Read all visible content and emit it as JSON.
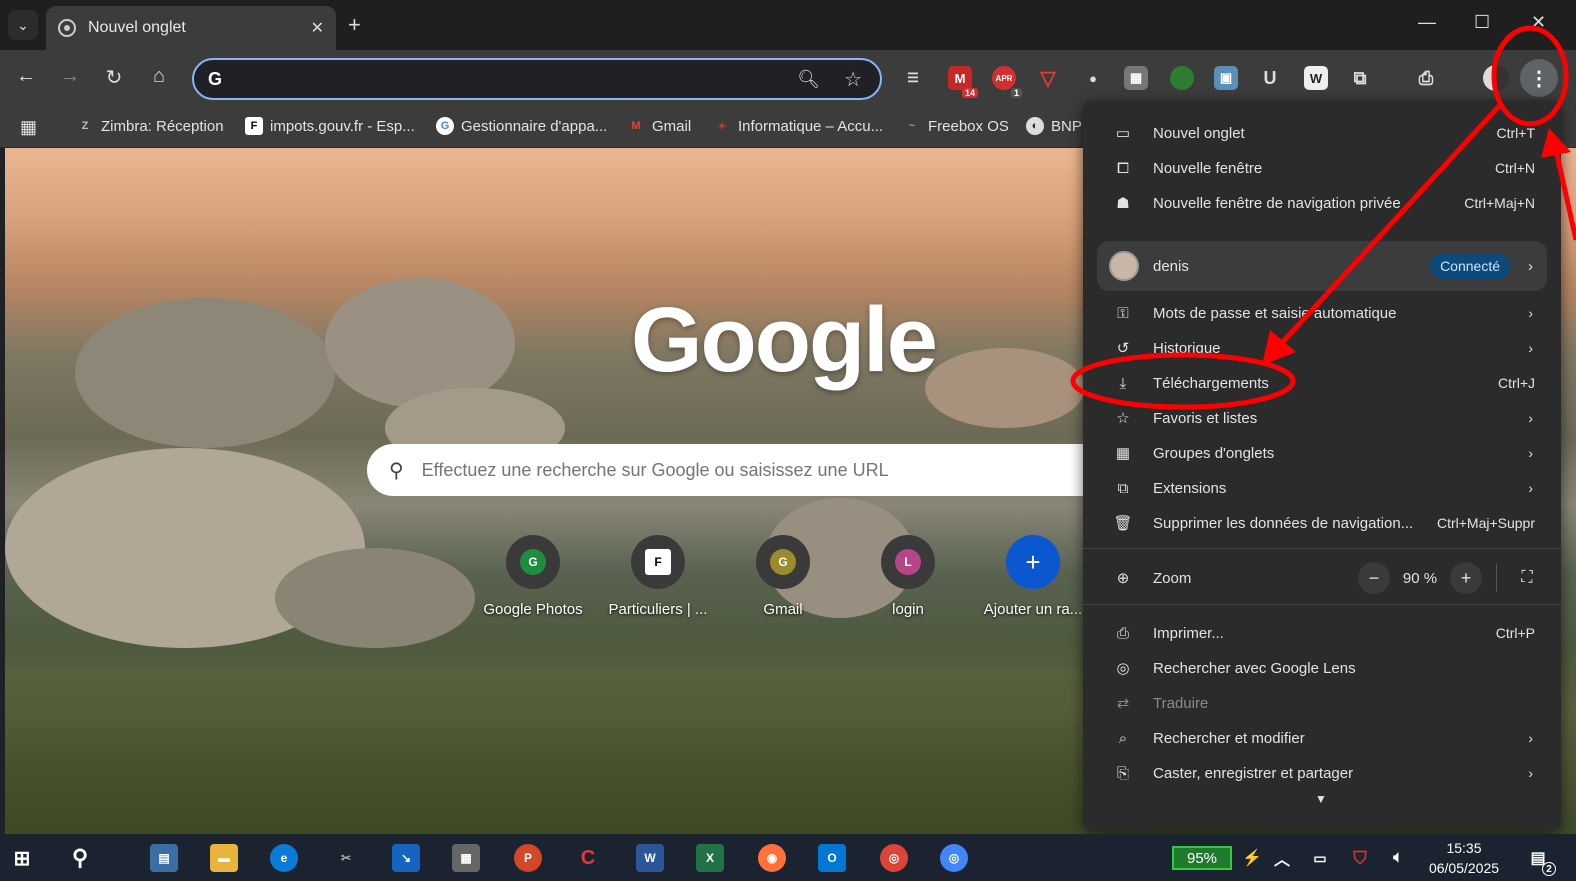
{
  "tab": {
    "title": "Nouvel onglet"
  },
  "omnibox": {
    "value": "",
    "placeholder": ""
  },
  "bookmarks": [
    {
      "label": "Zimbra: Réception",
      "icon": "zimbra-icon"
    },
    {
      "label": "impots.gouv.fr - Esp...",
      "icon": "impots-icon"
    },
    {
      "label": "Gestionnaire d'appa...",
      "icon": "google-icon"
    },
    {
      "label": "Gmail",
      "icon": "gmail-icon"
    },
    {
      "label": "Informatique – Accu...",
      "icon": "informatique-icon"
    },
    {
      "label": "Freebox OS",
      "icon": "freebox-icon"
    },
    {
      "label": "BNP",
      "icon": "bnp-icon"
    }
  ],
  "extensions": {
    "badge_14": "14",
    "badge_1": "1",
    "ext_apr": "APR"
  },
  "page": {
    "logo": "Google",
    "search_placeholder": "Effectuez une recherche sur Google ou saisissez une URL",
    "shortcuts": [
      {
        "label": "Google Photos",
        "letter": "G",
        "color": "#1e8e3e"
      },
      {
        "label": "Particuliers | ...",
        "letter": "F",
        "color": "#ffffff"
      },
      {
        "label": "Gmail",
        "letter": "G",
        "color": "#9a8b2b"
      },
      {
        "label": "login",
        "letter": "L",
        "color": "#b5468a"
      },
      {
        "label": "Ajouter un ra...",
        "letter": "+",
        "color": "#0b57d0"
      }
    ]
  },
  "menu": {
    "items_top": [
      {
        "label": "Nouvel onglet",
        "shortcut": "Ctrl+T",
        "icon": "new-tab-icon"
      },
      {
        "label": "Nouvelle fenêtre",
        "shortcut": "Ctrl+N",
        "icon": "new-window-icon"
      },
      {
        "label": "Nouvelle fenêtre de navigation privée",
        "shortcut": "Ctrl+Maj+N",
        "icon": "incognito-icon"
      }
    ],
    "profile": {
      "name": "denis",
      "status": "Connecté"
    },
    "items_mid": [
      {
        "label": "Mots de passe et saisie automatique",
        "shortcut": "",
        "chevron": true,
        "icon": "key-icon"
      },
      {
        "label": "Historique",
        "shortcut": "",
        "chevron": true,
        "icon": "history-icon"
      },
      {
        "label": "Téléchargements",
        "shortcut": "Ctrl+J",
        "chevron": false,
        "icon": "download-icon"
      },
      {
        "label": "Favoris et listes",
        "shortcut": "",
        "chevron": true,
        "icon": "star-icon"
      },
      {
        "label": "Groupes d'onglets",
        "shortcut": "",
        "chevron": true,
        "icon": "tab-groups-icon"
      },
      {
        "label": "Extensions",
        "shortcut": "",
        "chevron": true,
        "icon": "extensions-icon"
      },
      {
        "label": "Supprimer les données de navigation...",
        "shortcut": "Ctrl+Maj+Suppr",
        "chevron": false,
        "icon": "trash-icon"
      }
    ],
    "zoom": {
      "label": "Zoom",
      "value": "90 %",
      "minus": "−",
      "plus": "+"
    },
    "items_bottom": [
      {
        "label": "Imprimer...",
        "shortcut": "Ctrl+P",
        "chevron": false,
        "icon": "print-icon"
      },
      {
        "label": "Rechercher avec Google Lens",
        "shortcut": "",
        "chevron": false,
        "icon": "lens-icon"
      },
      {
        "label": "Traduire",
        "shortcut": "",
        "chevron": false,
        "icon": "translate-icon",
        "disabled": true
      },
      {
        "label": "Rechercher et modifier",
        "shortcut": "",
        "chevron": true,
        "icon": "find-icon"
      },
      {
        "label": "Caster, enregistrer et partager",
        "shortcut": "",
        "chevron": true,
        "icon": "cast-icon"
      }
    ]
  },
  "taskbar": {
    "battery": "95%",
    "time": "15:35",
    "date": "06/05/2025",
    "notif_count": "2"
  },
  "colors": {
    "accent": "#8ab4f8",
    "annotation": "#ff0000",
    "menu_bg": "#2b2b2b"
  }
}
